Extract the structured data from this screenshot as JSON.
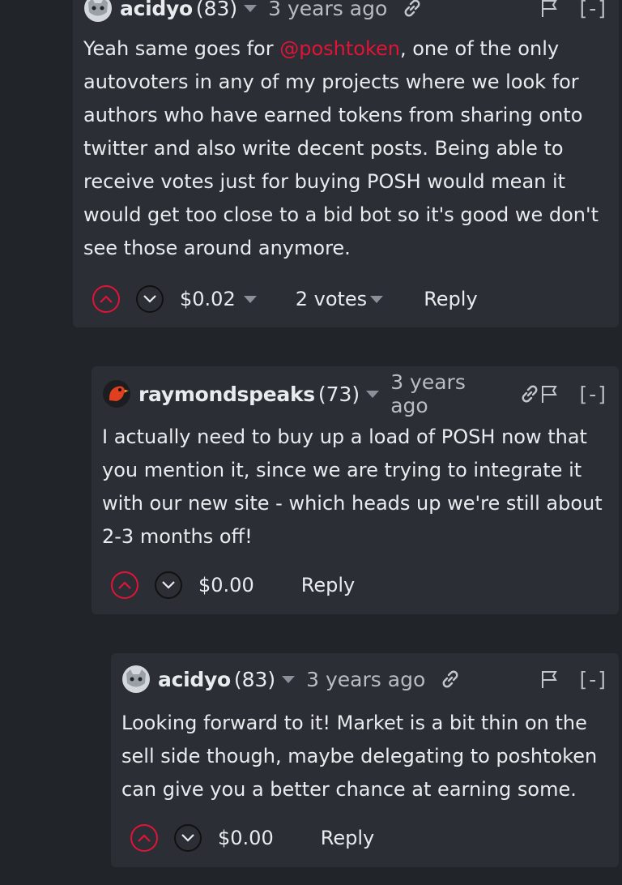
{
  "comments": [
    {
      "author": "acidyo",
      "reputation": "(83)",
      "time": "3 years ago",
      "collapse": "[-]",
      "text_before": "Yeah same goes for ",
      "mention": "@poshtoken",
      "text_after": ", one of the only autovoters in any of my projects where we look for authors who have earned tokens from sharing onto twitter and also write decent posts. Being able to receive votes just for buying POSH would mean it would get too close to a bid bot so it's good we don't see those around anymore.",
      "payout": "$0.02",
      "votes": "2 votes",
      "reply": "Reply",
      "avatar": "cat-avatar"
    },
    {
      "author": "raymondspeaks",
      "reputation": "(73)",
      "time": "3 years ago",
      "collapse": "[-]",
      "text": "I actually need to buy up a load of POSH now that you mention it, since we are trying to integrate it with our new site - which heads up we're still about 2-3 months off!",
      "payout": "$0.00",
      "reply": "Reply",
      "avatar": "bird-avatar"
    },
    {
      "author": "acidyo",
      "reputation": "(83)",
      "time": "3 years ago",
      "collapse": "[-]",
      "text": "Looking forward to it! Market is a bit thin on the sell side though, maybe delegating to poshtoken can give you a better chance at earning some.",
      "payout": "$0.00",
      "reply": "Reply",
      "avatar": "cat-avatar"
    }
  ],
  "colors": {
    "page_bg": "#212429",
    "card_bg": "#2b2e34",
    "accent": "#e31337"
  },
  "icons": [
    "chevron-down-icon",
    "link-icon",
    "flag-icon",
    "upvote-icon",
    "downvote-icon"
  ]
}
